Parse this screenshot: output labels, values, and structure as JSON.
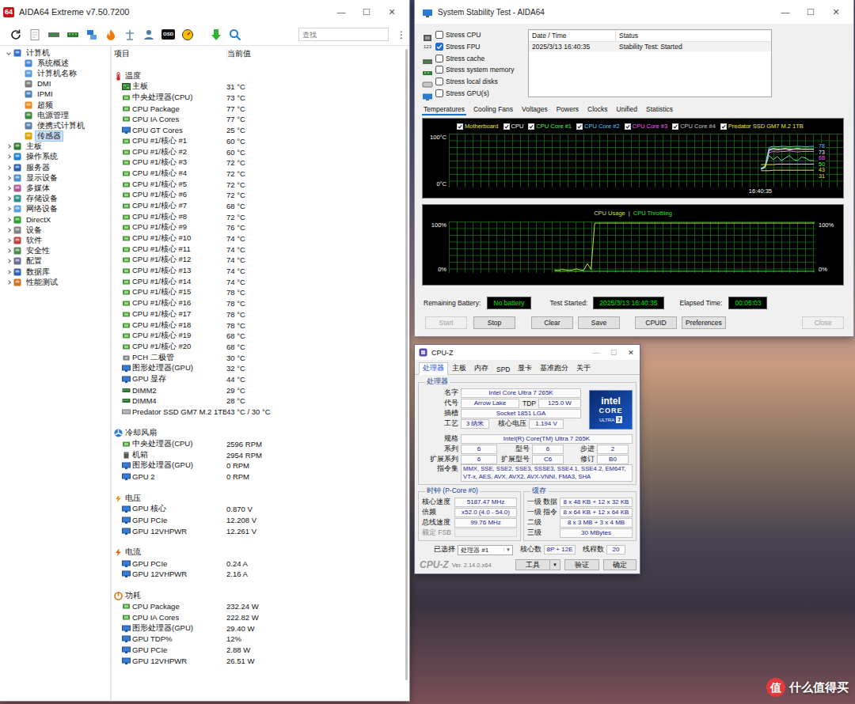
{
  "desktop": {
    "watermark": {
      "logo": "值",
      "text": "什么值得买"
    }
  },
  "aida": {
    "title": "AIDA64 Extreme v7.50.7200",
    "badge": "64",
    "controls": [
      "—",
      "☐",
      "✕"
    ],
    "toolbar": {
      "osd": "OSD",
      "search_placeholder": "查找",
      "menu": "⋮"
    },
    "tree": [
      {
        "text": "计算机",
        "kind": "group",
        "expanded": true,
        "selected": false
      },
      {
        "text": "系统概述",
        "kind": "leaf",
        "selected": false
      },
      {
        "text": "计算机名称",
        "kind": "leaf",
        "selected": false
      },
      {
        "text": "DMI",
        "kind": "leaf",
        "selected": false
      },
      {
        "text": "IPMI",
        "kind": "leaf",
        "selected": false
      },
      {
        "text": "超频",
        "kind": "leaf",
        "selected": false
      },
      {
        "text": "电源管理",
        "kind": "leaf",
        "selected": false
      },
      {
        "text": "便携式计算机",
        "kind": "leaf",
        "selected": false
      },
      {
        "text": "传感器",
        "kind": "leaf",
        "selected": true
      },
      {
        "text": "主板",
        "kind": "group",
        "expanded": false,
        "selected": false
      },
      {
        "text": "操作系统",
        "kind": "group",
        "expanded": false,
        "selected": false
      },
      {
        "text": "服务器",
        "kind": "group",
        "expanded": false,
        "selected": false
      },
      {
        "text": "显示设备",
        "kind": "group",
        "expanded": false,
        "selected": false
      },
      {
        "text": "多媒体",
        "kind": "group",
        "expanded": false,
        "selected": false
      },
      {
        "text": "存储设备",
        "kind": "group",
        "expanded": false,
        "selected": false
      },
      {
        "text": "网络设备",
        "kind": "group",
        "expanded": false,
        "selected": false
      },
      {
        "text": "DirectX",
        "kind": "group",
        "expanded": false,
        "selected": false
      },
      {
        "text": "设备",
        "kind": "group",
        "expanded": false,
        "selected": false
      },
      {
        "text": "软件",
        "kind": "group",
        "expanded": false,
        "selected": false
      },
      {
        "text": "安全性",
        "kind": "group",
        "expanded": false,
        "selected": false
      },
      {
        "text": "配置",
        "kind": "group",
        "expanded": false,
        "selected": false
      },
      {
        "text": "数据库",
        "kind": "group",
        "expanded": false,
        "selected": false
      },
      {
        "text": "性能测试",
        "kind": "group",
        "expanded": false,
        "selected": false
      }
    ],
    "columns": [
      "项目",
      "当前值"
    ],
    "sections": [
      {
        "title": "温度",
        "kind": "temp",
        "rows": [
          {
            "item": "主板",
            "value": "31 °C",
            "kind": "board"
          },
          {
            "item": "中央处理器(CPU)",
            "value": "73 °C",
            "kind": "cpu"
          },
          {
            "item": "CPU Package",
            "value": "77 °C",
            "kind": "cpu"
          },
          {
            "item": "CPU IA Cores",
            "value": "77 °C",
            "kind": "cpu"
          },
          {
            "item": "CPU GT Cores",
            "value": "25 °C",
            "kind": "gpu"
          },
          {
            "item": "CPU #1/核心 #1",
            "value": "60 °C",
            "kind": "cpu"
          },
          {
            "item": "CPU #1/核心 #2",
            "value": "60 °C",
            "kind": "cpu"
          },
          {
            "item": "CPU #1/核心 #3",
            "value": "72 °C",
            "kind": "cpu"
          },
          {
            "item": "CPU #1/核心 #4",
            "value": "72 °C",
            "kind": "cpu"
          },
          {
            "item": "CPU #1/核心 #5",
            "value": "72 °C",
            "kind": "cpu"
          },
          {
            "item": "CPU #1/核心 #6",
            "value": "72 °C",
            "kind": "cpu"
          },
          {
            "item": "CPU #1/核心 #7",
            "value": "68 °C",
            "kind": "cpu"
          },
          {
            "item": "CPU #1/核心 #8",
            "value": "72 °C",
            "kind": "cpu"
          },
          {
            "item": "CPU #1/核心 #9",
            "value": "76 °C",
            "kind": "cpu"
          },
          {
            "item": "CPU #1/核心 #10",
            "value": "74 °C",
            "kind": "cpu"
          },
          {
            "item": "CPU #1/核心 #11",
            "value": "74 °C",
            "kind": "cpu"
          },
          {
            "item": "CPU #1/核心 #12",
            "value": "74 °C",
            "kind": "cpu"
          },
          {
            "item": "CPU #1/核心 #13",
            "value": "74 °C",
            "kind": "cpu"
          },
          {
            "item": "CPU #1/核心 #14",
            "value": "74 °C",
            "kind": "cpu"
          },
          {
            "item": "CPU #1/核心 #15",
            "value": "78 °C",
            "kind": "cpu"
          },
          {
            "item": "CPU #1/核心 #16",
            "value": "78 °C",
            "kind": "cpu"
          },
          {
            "item": "CPU #1/核心 #17",
            "value": "78 °C",
            "kind": "cpu"
          },
          {
            "item": "CPU #1/核心 #18",
            "value": "78 °C",
            "kind": "cpu"
          },
          {
            "item": "CPU #1/核心 #19",
            "value": "68 °C",
            "kind": "cpu"
          },
          {
            "item": "CPU #1/核心 #20",
            "value": "68 °C",
            "kind": "cpu"
          },
          {
            "item": "PCH 二极管",
            "value": "30 °C",
            "kind": "chip"
          },
          {
            "item": "图形处理器(GPU)",
            "value": "32 °C",
            "kind": "gpu"
          },
          {
            "item": "GPU 显存",
            "value": "44 °C",
            "kind": "gpu"
          },
          {
            "item": "DIMM2",
            "value": "29 °C",
            "kind": "ram"
          },
          {
            "item": "DIMM4",
            "value": "28 °C",
            "kind": "ram"
          },
          {
            "item": "Predator SSD GM7 M.2 1TB",
            "value": "43 °C / 30 °C",
            "kind": "disk"
          }
        ]
      },
      {
        "title": "冷却风扇",
        "kind": "fan",
        "rows": [
          {
            "item": "中央处理器(CPU)",
            "value": "2596 RPM",
            "kind": "cpu"
          },
          {
            "item": "机箱",
            "value": "2954 RPM",
            "kind": "case"
          },
          {
            "item": "图形处理器(GPU)",
            "value": "0 RPM",
            "kind": "gpu"
          },
          {
            "item": "GPU 2",
            "value": "0 RPM",
            "kind": "gpu"
          }
        ]
      },
      {
        "title": "电压",
        "kind": "volt",
        "rows": [
          {
            "item": "GPU 核心",
            "value": "0.870 V",
            "kind": "gpu"
          },
          {
            "item": "GPU PCIe",
            "value": "12.208 V",
            "kind": "gpu"
          },
          {
            "item": "GPU 12VHPWR",
            "value": "12.261 V",
            "kind": "gpu"
          }
        ]
      },
      {
        "title": "电流",
        "kind": "amp",
        "rows": [
          {
            "item": "GPU PCIe",
            "value": "0.24 A",
            "kind": "gpu"
          },
          {
            "item": "GPU 12VHPWR",
            "value": "2.16 A",
            "kind": "gpu"
          }
        ]
      },
      {
        "title": "功耗",
        "kind": "power",
        "rows": [
          {
            "item": "CPU Package",
            "value": "232.24 W",
            "kind": "cpu"
          },
          {
            "item": "CPU IA Cores",
            "value": "222.82 W",
            "kind": "cpu"
          },
          {
            "item": "图形处理器(GPU)",
            "value": "29.40 W",
            "kind": "gpu"
          },
          {
            "item": "GPU TDP%",
            "value": "12%",
            "kind": "gpu"
          },
          {
            "item": "GPU PCIe",
            "value": "2.88 W",
            "kind": "gpu"
          },
          {
            "item": "GPU 12VHPWR",
            "value": "26.51 W",
            "kind": "gpu"
          }
        ]
      }
    ]
  },
  "stability": {
    "title": "System Stability Test - AIDA64",
    "controls": [
      "—",
      "☐",
      "✕"
    ],
    "options": [
      {
        "label": "Stress CPU",
        "checked": false
      },
      {
        "label": "Stress FPU",
        "checked": true,
        "badge": "123"
      },
      {
        "label": "Stress cache",
        "checked": false
      },
      {
        "label": "Stress system memory",
        "checked": false
      },
      {
        "label": "Stress local disks",
        "checked": false
      },
      {
        "label": "Stress GPU(s)",
        "checked": false
      }
    ],
    "log": {
      "columns": [
        "Date / Time",
        "Status"
      ],
      "rows": [
        [
          "2025/3/13 16:40:35",
          "Stability Test: Started"
        ]
      ]
    },
    "tabs": [
      {
        "label": "Temperatures",
        "selected": true
      },
      {
        "label": "Cooling Fans",
        "selected": false
      },
      {
        "label": "Voltages",
        "selected": false
      },
      {
        "label": "Powers",
        "selected": false
      },
      {
        "label": "Clocks",
        "selected": false
      },
      {
        "label": "Unified",
        "selected": false
      },
      {
        "label": "Statistics",
        "selected": false
      }
    ],
    "temp_chart": {
      "y_max": "100°C",
      "y_min": "0°C",
      "time": "16:40:35",
      "series": [
        {
          "label": "Motherboard",
          "checked": true,
          "color": "#e8e84a",
          "reading": "31",
          "values": [
            30,
            30,
            30,
            31,
            31,
            31,
            31,
            31,
            31,
            31,
            31,
            31,
            31,
            31
          ]
        },
        {
          "label": "CPU",
          "checked": true,
          "color": "#ffffff",
          "reading": "73",
          "values": [
            35,
            38,
            72,
            74,
            73,
            73,
            74,
            73,
            73,
            74,
            73,
            73,
            73,
            73
          ]
        },
        {
          "label": "CPU Core #1",
          "checked": true,
          "color": "#5cf05c",
          "reading": "50",
          "values": [
            33,
            36,
            60,
            52,
            58,
            50,
            55,
            60,
            52,
            50,
            57,
            55,
            50,
            50
          ]
        },
        {
          "label": "CPU Core #2",
          "checked": true,
          "color": "#5cc8ff",
          "reading": "78",
          "values": [
            34,
            40,
            76,
            78,
            77,
            78,
            78,
            77,
            78,
            78,
            78,
            77,
            78,
            78
          ]
        },
        {
          "label": "CPU Core #3",
          "checked": true,
          "color": "#ff5cff",
          "reading": "68",
          "values": [
            33,
            37,
            66,
            68,
            67,
            68,
            68,
            69,
            68,
            67,
            68,
            68,
            68,
            68
          ]
        },
        {
          "label": "CPU Core #4",
          "checked": true,
          "color": "#c8c8c8",
          "values": [
            33,
            37,
            70,
            72,
            71,
            72,
            72,
            71,
            72,
            72,
            72,
            72,
            72,
            72
          ]
        },
        {
          "label": "Predator SSD GM7 M.2 1TB",
          "checked": true,
          "color": "#f0f000",
          "reading": "43",
          "values": [
            42,
            42,
            42,
            42,
            43,
            43,
            43,
            43,
            43,
            43,
            43,
            43,
            43,
            43
          ]
        }
      ]
    },
    "usage_chart": {
      "separator": "|",
      "y_max_left": "100%",
      "y_min_left": "0%",
      "y_max_right": "100%",
      "y_min_right": "0%",
      "series": [
        {
          "label": "CPU Usage",
          "color": "#c8e632",
          "values": [
            3,
            2,
            4,
            3,
            2,
            3,
            5,
            3,
            2,
            16,
            4,
            100,
            100,
            100,
            100,
            100,
            100,
            100,
            100,
            100,
            100,
            100,
            100,
            100,
            100,
            100,
            100,
            100,
            100,
            100,
            100,
            100,
            100,
            100,
            100,
            100,
            100,
            100,
            100,
            100,
            100,
            100,
            100,
            100,
            100,
            100,
            100,
            100,
            100,
            100,
            100,
            100,
            100,
            100,
            100,
            100,
            100,
            100,
            100,
            100,
            100,
            100,
            100,
            100,
            100,
            100,
            100,
            100,
            100,
            100,
            100,
            100
          ]
        },
        {
          "label": "CPU Throttling",
          "color": "#2fe62f",
          "values": [
            0,
            0,
            0,
            0,
            0,
            0,
            0,
            0,
            0,
            0,
            0,
            0,
            0,
            0,
            0,
            0,
            0,
            0,
            0,
            0,
            0,
            0,
            0,
            0,
            0,
            0,
            0,
            0,
            0,
            0,
            0,
            0,
            0,
            0,
            0,
            0,
            0,
            0,
            0,
            0,
            0,
            0,
            0,
            0,
            0,
            0,
            0,
            0,
            0,
            0,
            0,
            0,
            0,
            0,
            0,
            0,
            0,
            0,
            0,
            0,
            0,
            0,
            0,
            0,
            0,
            0,
            0,
            0,
            0,
            0,
            0,
            0
          ]
        }
      ]
    },
    "status": [
      {
        "label": "Remaining Battery:",
        "value": "No battery"
      },
      {
        "label": "Test Started:",
        "value": "2025/3/13 16:40:35"
      },
      {
        "label": "Elapsed Time:",
        "value": "00:05:03"
      }
    ],
    "buttons": [
      {
        "label": "Start",
        "disabled": true
      },
      {
        "label": "Stop",
        "disabled": false
      },
      {
        "label": "Clear",
        "disabled": false
      },
      {
        "label": "Save",
        "disabled": false
      },
      {
        "label": "CPUID",
        "disabled": false
      },
      {
        "label": "Preferences",
        "disabled": false
      },
      {
        "label": "Close",
        "disabled": true
      }
    ]
  },
  "cpuz": {
    "title": "CPU-Z",
    "controls": [
      "—",
      "☐",
      "✕"
    ],
    "tabs": [
      {
        "label": "处理器",
        "selected": true
      },
      {
        "label": "主板",
        "selected": false
      },
      {
        "label": "内存",
        "selected": false
      },
      {
        "label": "SPD",
        "selected": false
      },
      {
        "label": "显卡",
        "selected": false
      },
      {
        "label": "基准跑分",
        "selected": false
      },
      {
        "label": "关于",
        "selected": false
      }
    ],
    "processor": {
      "legend": "处理器",
      "name": {
        "label": "名字",
        "value": "Intel Core Ultra 7 265K"
      },
      "codename": {
        "label": "代号",
        "value": "Arrow Lake"
      },
      "tdp": {
        "label": "TDP",
        "value": "125.0 W"
      },
      "socket": {
        "label": "插槽",
        "value": "Socket 1851 LGA"
      },
      "process": {
        "label": "工艺",
        "value": "3 纳米"
      },
      "voltage": {
        "label": "核心电压",
        "value": "1.194 V"
      },
      "spec": {
        "label": "规格",
        "value": "Intel(R) Core(TM) Ultra 7 265K"
      },
      "family": {
        "label": "系列",
        "value": "6"
      },
      "model": {
        "label": "型号",
        "value": "6"
      },
      "stepping": {
        "label": "步进",
        "value": "2"
      },
      "ext_family": {
        "label": "扩展系列",
        "value": "6"
      },
      "ext_model": {
        "label": "扩展型号",
        "value": "C6"
      },
      "revision": {
        "label": "修订",
        "value": "B0"
      },
      "instructions": {
        "label": "指令集",
        "value": "MMX, SSE, SSE2, SSE3, SSSE3, SSE4.1, SSE4.2, EM64T, VT-x, AES, AVX, AVX2, AVX-VNNI, FMA3, SHA"
      }
    },
    "logo": {
      "brand": "intel",
      "line": "CORE",
      "tier": "ULTRA",
      "number": "7"
    },
    "clocks": {
      "legend": "时钟 (P-Core #0)",
      "rows": [
        {
          "label": "核心速度",
          "value": "5187.47 MHz",
          "disabled": false
        },
        {
          "label": "倍频",
          "value": "x52.0 (4.0 - 54.0)",
          "disabled": false
        },
        {
          "label": "总线速度",
          "value": "99.76 MHz",
          "disabled": false
        },
        {
          "label": "额定 FSB",
          "value": "",
          "disabled": true
        }
      ]
    },
    "cache": {
      "legend": "缓存",
      "rows": [
        {
          "label": "一级 数据",
          "value": "8 x 48 KB + 12 x 32 KB"
        },
        {
          "label": "一级 指令",
          "value": "8 x 64 KB + 12 x 64 KB"
        },
        {
          "label": "二级",
          "value": "8 x 3 MB + 3 x 4 MB"
        },
        {
          "label": "三级",
          "value": "30 MBytes"
        }
      ]
    },
    "selection": {
      "label": "已选择",
      "value": "处理器 #1",
      "arrow": "▼"
    },
    "cores": {
      "label": "核心数",
      "value": "8P + 12E"
    },
    "threads": {
      "label": "线程数",
      "value": "20"
    },
    "footer": {
      "brand": "CPU-Z",
      "version": "Ver. 2.14.0.x64",
      "buttons": [
        {
          "label": "工具",
          "arrow": "▼"
        },
        {
          "label": "验证"
        },
        {
          "label": "确定"
        }
      ]
    }
  }
}
